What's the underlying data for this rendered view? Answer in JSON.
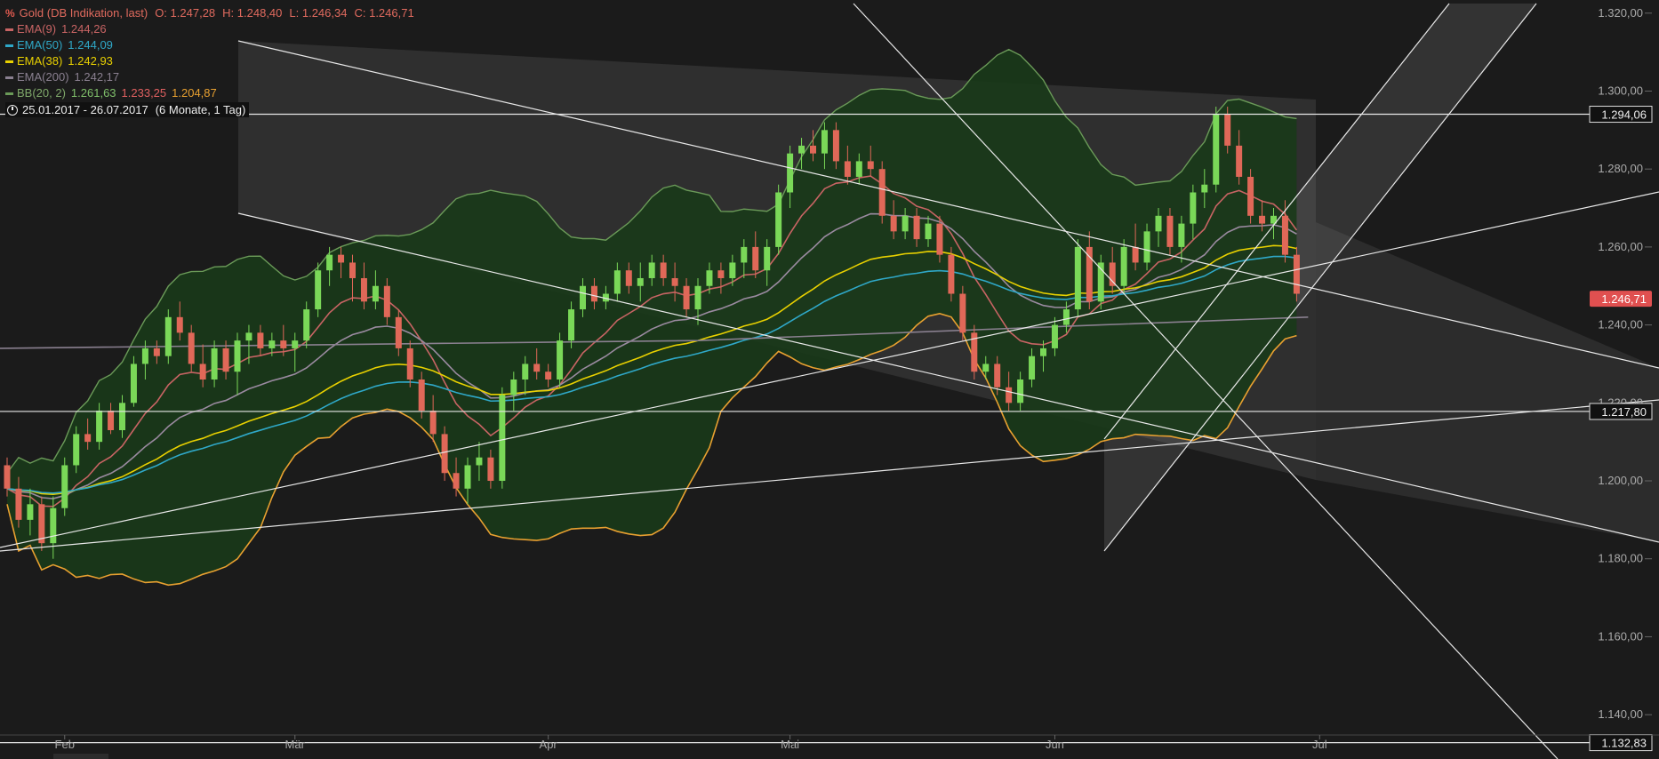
{
  "header": {
    "logo": "%",
    "instrument": "Gold (DB Indikation, last)",
    "ohlc": [
      {
        "label": "O:",
        "value": "1.247,28"
      },
      {
        "label": "H:",
        "value": "1.248,40"
      },
      {
        "label": "L:",
        "value": "1.246,34"
      },
      {
        "label": "C:",
        "value": "1.246,71"
      }
    ],
    "range_text": "25.01.2017 - 26.07.2017",
    "interval_text": "(6 Monate, 1 Tag)"
  },
  "indicators": [
    {
      "name": "EMA(9)",
      "values": [
        "1.244,26"
      ],
      "color": "#c86464"
    },
    {
      "name": "EMA(50)",
      "values": [
        "1.244,09"
      ],
      "color": "#2fa8c8"
    },
    {
      "name": "EMA(38)",
      "values": [
        "1.242,93"
      ],
      "color": "#e8d000"
    },
    {
      "name": "EMA(200)",
      "values": [
        "1.242,17"
      ],
      "color": "#8a8090"
    },
    {
      "name": "BB(20, 2)",
      "values": [
        "1.261,63",
        "1.233,25",
        "1.204,87"
      ],
      "color": "#6a9a58",
      "value_colors": [
        "#7fbf6a",
        "#e06060",
        "#e8a030"
      ]
    }
  ],
  "colors": {
    "background": "#1b1b1b",
    "up": "#7ad858",
    "down": "#e06858",
    "bb_fill": "#1a3a1a",
    "bb_line": "#6a9a58",
    "ema9": "#c86464",
    "ema20": "#9a8aa0",
    "ema38": "#e8d000",
    "ema50": "#2fa8c8",
    "ema200": "#8a8090",
    "bb_lower": "#e8a030",
    "grid": "#e0e0e0",
    "price_tag": "#e05050"
  },
  "chart_data": {
    "type": "candlestick",
    "x_labels": [
      "Feb",
      "Mär",
      "Apr",
      "Mai",
      "Jun",
      "Jul"
    ],
    "y_ticks": [
      "1.140,00",
      "1.160,00",
      "1.180,00",
      "1.200,00",
      "1.220,00",
      "1.240,00",
      "1.260,00",
      "1.280,00",
      "1.300,00",
      "1.320,00"
    ],
    "y_tick_values": [
      1140,
      1160,
      1180,
      1200,
      1220,
      1240,
      1260,
      1280,
      1300,
      1320
    ],
    "ylim": [
      1130,
      1322
    ],
    "month_start_index": [
      5,
      25,
      47,
      68,
      91,
      114
    ],
    "candles": [
      [
        1204,
        1206,
        1196,
        1198
      ],
      [
        1198,
        1201,
        1188,
        1190
      ],
      [
        1190,
        1198,
        1186,
        1194
      ],
      [
        1194,
        1196,
        1182,
        1184
      ],
      [
        1184,
        1196,
        1180,
        1193
      ],
      [
        1193,
        1206,
        1191,
        1204
      ],
      [
        1204,
        1214,
        1202,
        1212
      ],
      [
        1212,
        1216,
        1208,
        1210
      ],
      [
        1210,
        1220,
        1208,
        1218
      ],
      [
        1218,
        1220,
        1212,
        1213
      ],
      [
        1213,
        1222,
        1211,
        1220
      ],
      [
        1220,
        1232,
        1219,
        1230
      ],
      [
        1230,
        1236,
        1226,
        1234
      ],
      [
        1234,
        1236,
        1230,
        1232
      ],
      [
        1232,
        1244,
        1230,
        1242
      ],
      [
        1242,
        1246,
        1236,
        1238
      ],
      [
        1238,
        1240,
        1228,
        1230
      ],
      [
        1230,
        1235,
        1224,
        1226
      ],
      [
        1226,
        1236,
        1224,
        1234
      ],
      [
        1234,
        1236,
        1226,
        1228
      ],
      [
        1228,
        1238,
        1222,
        1236
      ],
      [
        1236,
        1240,
        1230,
        1238
      ],
      [
        1238,
        1240,
        1232,
        1234
      ],
      [
        1234,
        1238,
        1232,
        1236
      ],
      [
        1236,
        1240,
        1232,
        1234
      ],
      [
        1234,
        1238,
        1228,
        1236
      ],
      [
        1236,
        1246,
        1234,
        1244
      ],
      [
        1244,
        1256,
        1242,
        1254
      ],
      [
        1254,
        1260,
        1250,
        1258
      ],
      [
        1258,
        1260,
        1252,
        1256
      ],
      [
        1256,
        1258,
        1246,
        1252
      ],
      [
        1252,
        1256,
        1244,
        1246
      ],
      [
        1246,
        1254,
        1244,
        1250
      ],
      [
        1250,
        1252,
        1240,
        1242
      ],
      [
        1242,
        1244,
        1232,
        1234
      ],
      [
        1234,
        1236,
        1224,
        1226
      ],
      [
        1226,
        1228,
        1216,
        1218
      ],
      [
        1218,
        1222,
        1210,
        1212
      ],
      [
        1212,
        1214,
        1200,
        1202
      ],
      [
        1202,
        1206,
        1196,
        1198
      ],
      [
        1198,
        1206,
        1194,
        1204
      ],
      [
        1204,
        1210,
        1200,
        1206
      ],
      [
        1206,
        1208,
        1198,
        1200
      ],
      [
        1200,
        1224,
        1198,
        1222
      ],
      [
        1222,
        1228,
        1218,
        1226
      ],
      [
        1226,
        1232,
        1222,
        1230
      ],
      [
        1230,
        1234,
        1226,
        1228
      ],
      [
        1228,
        1230,
        1224,
        1226
      ],
      [
        1226,
        1238,
        1224,
        1236
      ],
      [
        1236,
        1246,
        1234,
        1244
      ],
      [
        1244,
        1252,
        1242,
        1250
      ],
      [
        1250,
        1252,
        1244,
        1246
      ],
      [
        1246,
        1250,
        1244,
        1248
      ],
      [
        1248,
        1256,
        1246,
        1254
      ],
      [
        1254,
        1256,
        1248,
        1250
      ],
      [
        1250,
        1256,
        1246,
        1252
      ],
      [
        1252,
        1258,
        1250,
        1256
      ],
      [
        1256,
        1258,
        1250,
        1252
      ],
      [
        1252,
        1256,
        1246,
        1250
      ],
      [
        1250,
        1252,
        1242,
        1244
      ],
      [
        1244,
        1252,
        1240,
        1250
      ],
      [
        1250,
        1256,
        1248,
        1254
      ],
      [
        1254,
        1256,
        1248,
        1252
      ],
      [
        1252,
        1258,
        1250,
        1256
      ],
      [
        1256,
        1262,
        1252,
        1260
      ],
      [
        1260,
        1264,
        1252,
        1254
      ],
      [
        1254,
        1262,
        1250,
        1260
      ],
      [
        1260,
        1276,
        1258,
        1274
      ],
      [
        1274,
        1286,
        1270,
        1284
      ],
      [
        1284,
        1288,
        1280,
        1286
      ],
      [
        1286,
        1290,
        1282,
        1284
      ],
      [
        1284,
        1292,
        1280,
        1290
      ],
      [
        1290,
        1292,
        1280,
        1282
      ],
      [
        1282,
        1286,
        1276,
        1278
      ],
      [
        1278,
        1284,
        1276,
        1282
      ],
      [
        1282,
        1286,
        1278,
        1280
      ],
      [
        1280,
        1282,
        1266,
        1268
      ],
      [
        1268,
        1272,
        1262,
        1264
      ],
      [
        1264,
        1270,
        1262,
        1268
      ],
      [
        1268,
        1270,
        1260,
        1262
      ],
      [
        1262,
        1268,
        1260,
        1266
      ],
      [
        1266,
        1268,
        1256,
        1258
      ],
      [
        1258,
        1260,
        1246,
        1248
      ],
      [
        1248,
        1250,
        1236,
        1238
      ],
      [
        1238,
        1240,
        1226,
        1228
      ],
      [
        1228,
        1232,
        1226,
        1230
      ],
      [
        1230,
        1232,
        1222,
        1224
      ],
      [
        1224,
        1228,
        1218,
        1220
      ],
      [
        1220,
        1228,
        1218,
        1226
      ],
      [
        1226,
        1234,
        1224,
        1232
      ],
      [
        1232,
        1236,
        1228,
        1234
      ],
      [
        1234,
        1242,
        1232,
        1240
      ],
      [
        1240,
        1246,
        1238,
        1244
      ],
      [
        1244,
        1262,
        1242,
        1260
      ],
      [
        1260,
        1264,
        1244,
        1246
      ],
      [
        1246,
        1258,
        1244,
        1256
      ],
      [
        1256,
        1260,
        1248,
        1250
      ],
      [
        1250,
        1262,
        1248,
        1260
      ],
      [
        1260,
        1266,
        1254,
        1256
      ],
      [
        1256,
        1266,
        1254,
        1264
      ],
      [
        1264,
        1270,
        1260,
        1268
      ],
      [
        1268,
        1270,
        1258,
        1260
      ],
      [
        1260,
        1268,
        1256,
        1266
      ],
      [
        1266,
        1276,
        1262,
        1274
      ],
      [
        1274,
        1280,
        1270,
        1276
      ],
      [
        1276,
        1296,
        1274,
        1294
      ],
      [
        1294,
        1296,
        1284,
        1286
      ],
      [
        1286,
        1290,
        1276,
        1278
      ],
      [
        1278,
        1280,
        1266,
        1268
      ],
      [
        1268,
        1272,
        1264,
        1266
      ],
      [
        1266,
        1270,
        1262,
        1268
      ],
      [
        1268,
        1272,
        1256,
        1258
      ],
      [
        1258,
        1260,
        1246,
        1248
      ]
    ],
    "price_levels": [
      {
        "label": "1.294,06",
        "value": 1294.06,
        "style": "box"
      },
      {
        "label": "1.246,71",
        "value": 1246.71,
        "style": "current"
      },
      {
        "label": "1.217,80",
        "value": 1217.8,
        "style": "box"
      },
      {
        "label": "1.132,83",
        "value": 1132.83,
        "style": "box"
      }
    ]
  }
}
